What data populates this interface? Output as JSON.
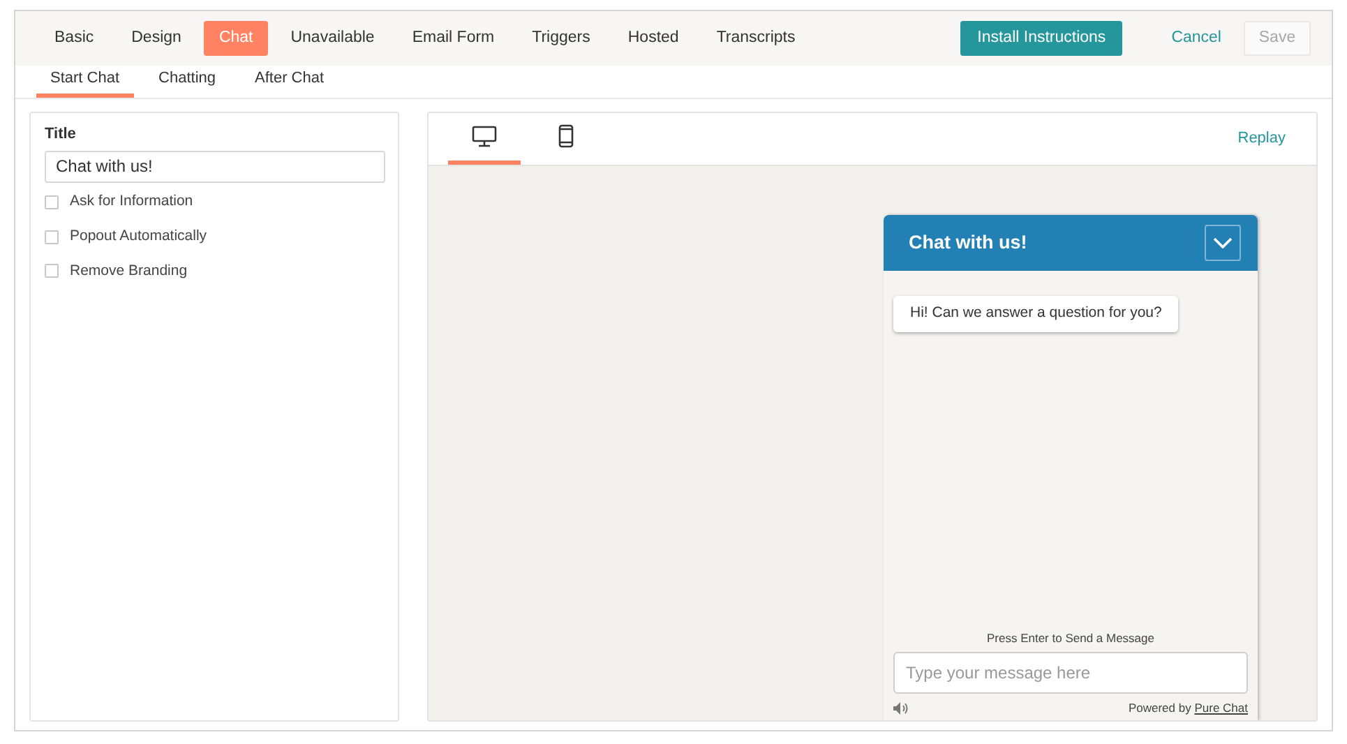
{
  "main_tabs": [
    {
      "label": "Basic",
      "selected": false
    },
    {
      "label": "Design",
      "selected": false
    },
    {
      "label": "Chat",
      "selected": true
    },
    {
      "label": "Unavailable",
      "selected": false
    },
    {
      "label": "Email Form",
      "selected": false
    },
    {
      "label": "Triggers",
      "selected": false
    },
    {
      "label": "Hosted",
      "selected": false
    },
    {
      "label": "Transcripts",
      "selected": false
    }
  ],
  "actions": {
    "install": "Install Instructions",
    "cancel": "Cancel",
    "save": {
      "label": "Save",
      "disabled": true
    }
  },
  "sub_tabs": [
    {
      "label": "Start Chat",
      "selected": true
    },
    {
      "label": "Chatting",
      "selected": false
    },
    {
      "label": "After Chat",
      "selected": false
    }
  ],
  "settings": {
    "title_label": "Title",
    "title_value": "Chat with us!",
    "options": [
      {
        "label": "Ask for Information",
        "checked": false
      },
      {
        "label": "Popout Automatically",
        "checked": false
      },
      {
        "label": "Remove Branding",
        "checked": false
      }
    ]
  },
  "preview": {
    "device_tabs": [
      {
        "kind": "desktop",
        "selected": true
      },
      {
        "kind": "mobile",
        "selected": false
      }
    ],
    "replay": "Replay",
    "widget": {
      "title": "Chat with us!",
      "greeting": "Hi! Can we answer a question for you?",
      "hint": "Press Enter to Send a Message",
      "placeholder": "Type your message here",
      "powered_by": "Powered by",
      "brand_link": "Pure Chat"
    }
  }
}
